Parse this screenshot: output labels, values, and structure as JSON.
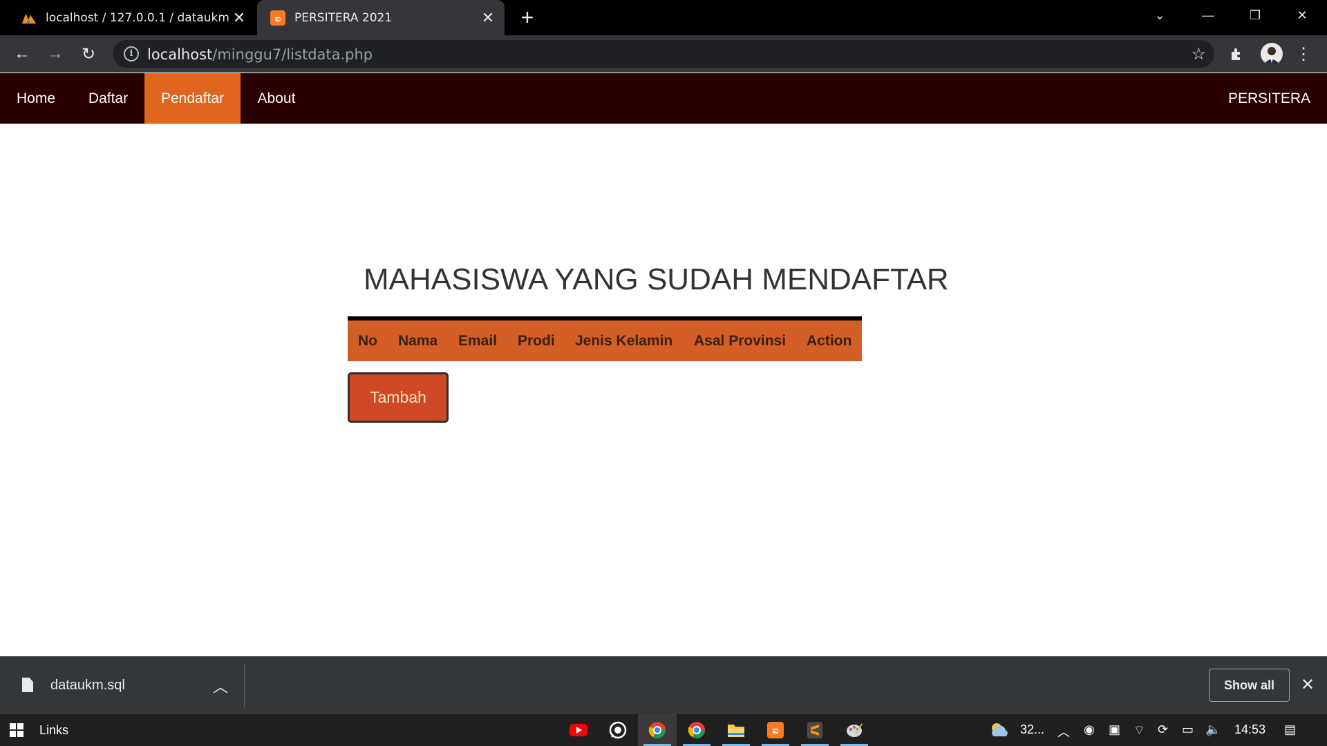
{
  "browser": {
    "tabs": [
      {
        "title": "localhost / 127.0.0.1 / dataukm | ",
        "active": false
      },
      {
        "title": "PERSITERA 2021",
        "active": true
      }
    ],
    "new_tab_symbol": "+",
    "url_host": "localhost",
    "url_path": "/minggu7/listdata.php"
  },
  "site": {
    "nav": [
      {
        "label": "Home",
        "active": false
      },
      {
        "label": "Daftar",
        "active": false
      },
      {
        "label": "Pendaftar",
        "active": true
      },
      {
        "label": "About",
        "active": false
      }
    ],
    "brand": "PERSITERA",
    "accent_color": "#e0661f",
    "nav_bg": "#2a0000"
  },
  "main": {
    "heading": "MAHASISWA YANG SUDAH MENDAFTAR",
    "table_headers": [
      "No",
      "Nama",
      "Email",
      "Prodi",
      "Jenis Kelamin",
      "Asal Provinsi",
      "Action"
    ],
    "add_button": "Tambah"
  },
  "download_shelf": {
    "file_name": "dataukm.sql",
    "show_all": "Show all"
  },
  "taskbar": {
    "search_label": "Links",
    "weather": "32...",
    "time": "14:53",
    "apps": [
      "youtube-icon",
      "whatsapp-icon",
      "chrome-icon",
      "chrome-icon",
      "file-explorer-icon",
      "xampp-icon",
      "sublime-text-icon",
      "paint-icon"
    ]
  }
}
